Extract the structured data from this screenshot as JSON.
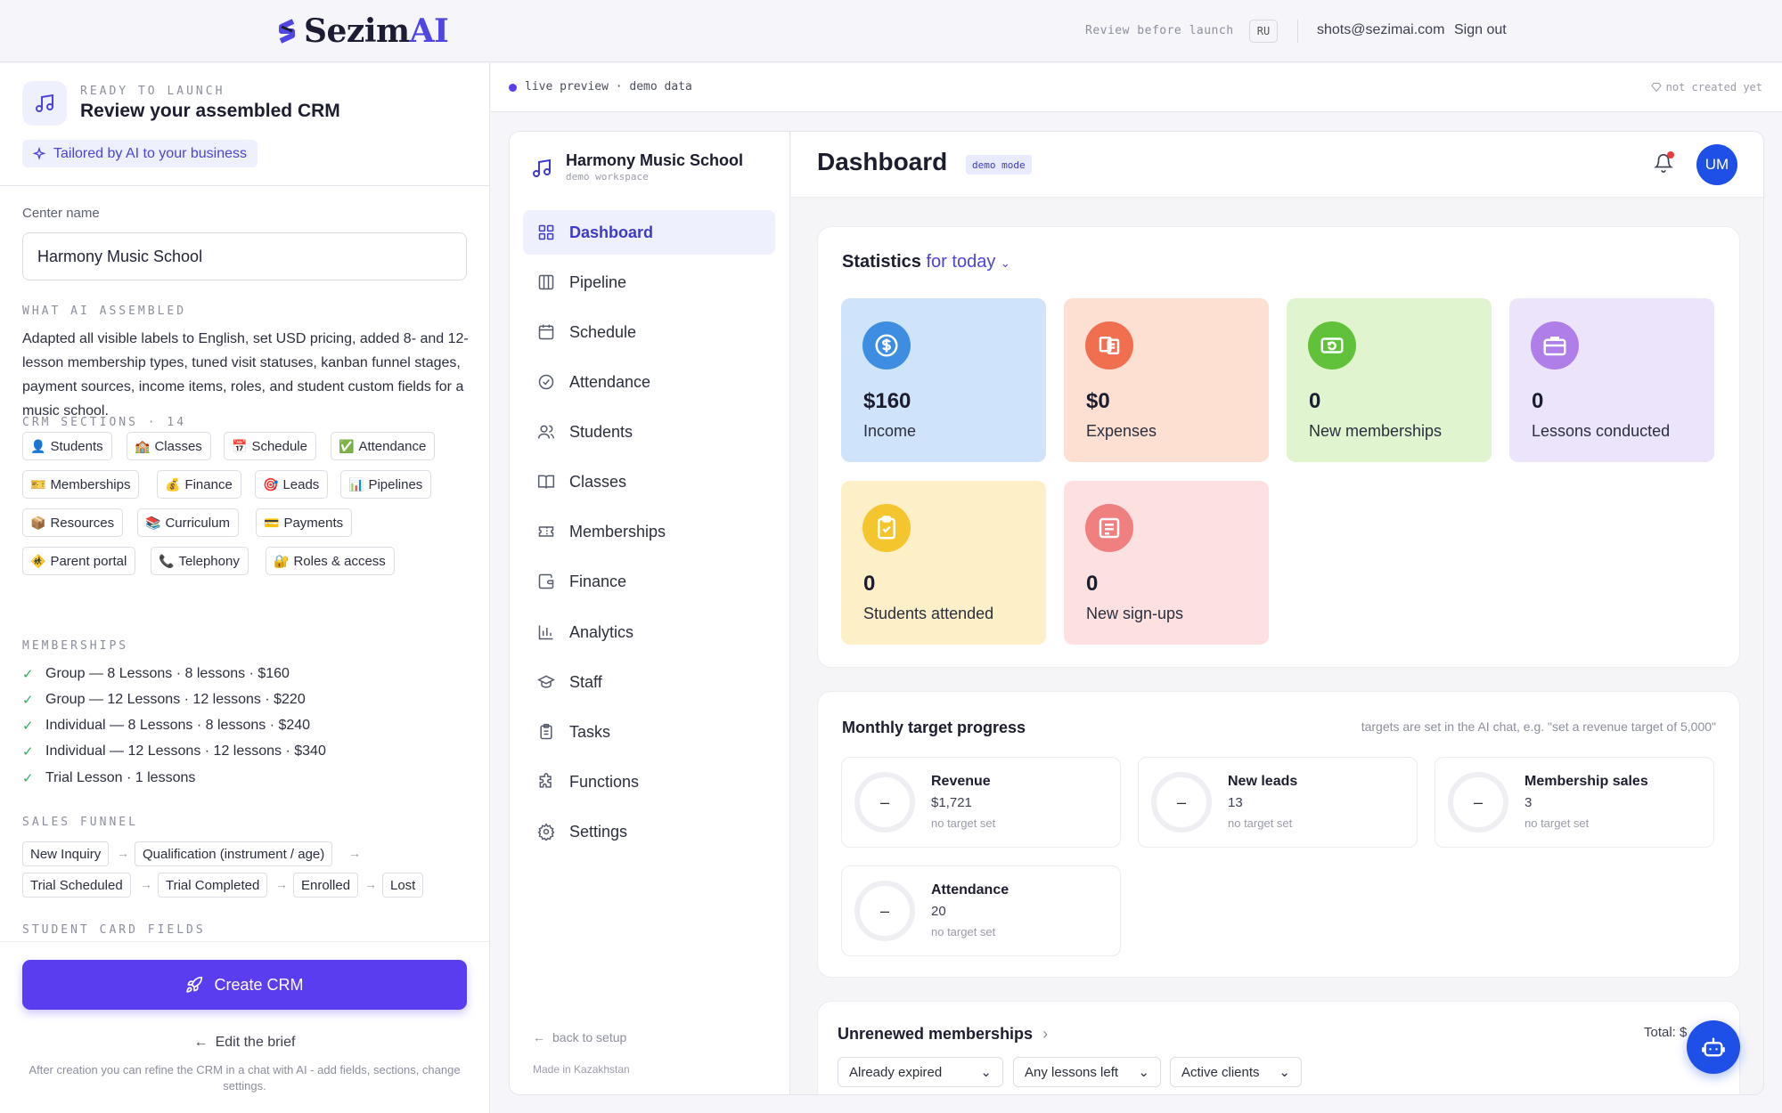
{
  "topbar": {
    "logo_prefix": "Sezim",
    "logo_suffix": "AI",
    "review_note": "Review before launch",
    "lang": "RU",
    "email": "shots@sezimai.com",
    "signout": "Sign out"
  },
  "left": {
    "ready_label": "READY TO LAUNCH",
    "title": "Review your assembled CRM",
    "tailored": "Tailored by AI to your business",
    "center_label": "Center name",
    "center_value": "Harmony Music School",
    "ai_label": "WHAT AI ASSEMBLED",
    "ai_desc": "Adapted all visible labels to English, set USD pricing, added 8- and 12-lesson membership types, tuned visit statuses, kanban funnel stages, payment sources, income items, roles, and student custom fields for a music school.",
    "sections_label": "CRM SECTIONS · 14",
    "sections": [
      {
        "emoji": "👤",
        "label": "Students"
      },
      {
        "emoji": "🏫",
        "label": "Classes"
      },
      {
        "emoji": "📅",
        "label": "Schedule"
      },
      {
        "emoji": "✅",
        "label": "Attendance"
      },
      {
        "emoji": "🎫",
        "label": "Memberships"
      },
      {
        "emoji": "💰",
        "label": "Finance"
      },
      {
        "emoji": "🎯",
        "label": "Leads"
      },
      {
        "emoji": "📊",
        "label": "Pipelines"
      },
      {
        "emoji": "📦",
        "label": "Resources"
      },
      {
        "emoji": "📚",
        "label": "Curriculum"
      },
      {
        "emoji": "💳",
        "label": "Payments"
      },
      {
        "emoji": "🚸",
        "label": "Parent portal"
      },
      {
        "emoji": "📞",
        "label": "Telephony"
      },
      {
        "emoji": "🔐",
        "label": "Roles & access"
      }
    ],
    "memberships_label": "MEMBERSHIPS",
    "memberships": [
      "Group — 8 Lessons · 8 lessons · $160",
      "Group — 12 Lessons · 12 lessons · $220",
      "Individual — 8 Lessons · 8 lessons · $240",
      "Individual — 12 Lessons · 12 lessons · $340",
      "Trial Lesson · 1 lessons"
    ],
    "funnel_label": "SALES FUNNEL",
    "funnel": [
      "New Inquiry",
      "Qualification (instrument / age)",
      "Trial Scheduled",
      "Trial Completed",
      "Enrolled",
      "Lost"
    ],
    "fields_label": "STUDENT CARD FIELDS",
    "create_btn": "Create CRM",
    "edit_brief": "Edit the brief",
    "after_note": "After creation you can refine the CRM in a chat with AI - add fields, sections, change settings."
  },
  "preview": {
    "live": "live preview · demo data",
    "status": "not created yet"
  },
  "sidebar": {
    "brand": "Harmony Music School",
    "brand_sub": "demo workspace",
    "items": [
      {
        "label": "Dashboard",
        "icon": "grid-icon"
      },
      {
        "label": "Pipeline",
        "icon": "columns-icon"
      },
      {
        "label": "Schedule",
        "icon": "calendar-icon"
      },
      {
        "label": "Attendance",
        "icon": "check-circle-icon"
      },
      {
        "label": "Students",
        "icon": "users-icon"
      },
      {
        "label": "Classes",
        "icon": "book-icon"
      },
      {
        "label": "Memberships",
        "icon": "ticket-icon"
      },
      {
        "label": "Finance",
        "icon": "wallet-icon"
      },
      {
        "label": "Analytics",
        "icon": "bar-chart-icon"
      },
      {
        "label": "Staff",
        "icon": "graduation-cap-icon"
      },
      {
        "label": "Tasks",
        "icon": "clipboard-icon"
      },
      {
        "label": "Functions",
        "icon": "puzzle-icon"
      },
      {
        "label": "Settings",
        "icon": "gear-icon"
      }
    ],
    "back": "back to setup",
    "made": "Made in Kazakhstan"
  },
  "main": {
    "title": "Dashboard",
    "demo_tag": "demo mode",
    "avatar": "UM",
    "stats_title": "Statistics",
    "stats_period": "for today",
    "stats": [
      {
        "value": "$160",
        "label": "Income",
        "bg": "#cfe3fb",
        "icon_bg": "#3d8ee3"
      },
      {
        "value": "$0",
        "label": "Expenses",
        "bg": "#fde0d2",
        "icon_bg": "#f06f4e"
      },
      {
        "value": "0",
        "label": "New memberships",
        "bg": "#dff4cf",
        "icon_bg": "#5fc23a"
      },
      {
        "value": "0",
        "label": "Lessons conducted",
        "bg": "#ece4fb",
        "icon_bg": "#b07ee8"
      },
      {
        "value": "0",
        "label": "Students attended",
        "bg": "#fdf0c8",
        "icon_bg": "#f4c52c"
      },
      {
        "value": "0",
        "label": "New sign-ups",
        "bg": "#fde1e1",
        "icon_bg": "#f07f7f"
      }
    ],
    "target_title": "Monthly target progress",
    "target_hint": "targets are set in the AI chat, e.g. \"set a revenue target of 5,000\"",
    "targets": [
      {
        "ring": "–",
        "name": "Revenue",
        "value": "$1,721",
        "status": "no target set"
      },
      {
        "ring": "–",
        "name": "New leads",
        "value": "13",
        "status": "no target set"
      },
      {
        "ring": "–",
        "name": "Membership sales",
        "value": "3",
        "status": "no target set"
      },
      {
        "ring": "–",
        "name": "Attendance",
        "value": "20",
        "status": "no target set"
      }
    ],
    "unrenewed_title": "Unrenewed memberships",
    "unrenewed_total": "Total: $",
    "filters": [
      "Already expired",
      "Any lessons left",
      "Active clients"
    ]
  }
}
